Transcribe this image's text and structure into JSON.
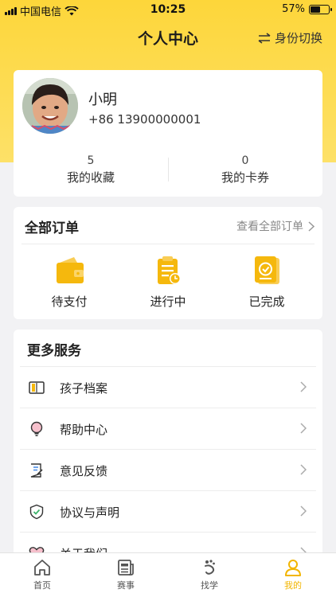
{
  "status_bar": {
    "carrier": "中国电信",
    "time": "10:25",
    "battery": "57%",
    "battery_level": 0.57
  },
  "header": {
    "title": "个人中心",
    "switch_label": "身份切换",
    "switch_icon": "swap-icon"
  },
  "profile": {
    "name": "小明",
    "phone": "+86 13900000001",
    "stats": [
      {
        "count": "5",
        "label": "我的收藏"
      },
      {
        "count": "0",
        "label": "我的卡券"
      }
    ]
  },
  "orders": {
    "title": "全部订单",
    "view_all": "查看全部订单",
    "items": [
      {
        "label": "待支付",
        "icon": "wallet-icon"
      },
      {
        "label": "进行中",
        "icon": "clipboard-clock-icon"
      },
      {
        "label": "已完成",
        "icon": "clipboard-check-icon"
      }
    ]
  },
  "services": {
    "title": "更多服务",
    "items": [
      {
        "label": "孩子档案",
        "icon": "folder-icon"
      },
      {
        "label": "帮助中心",
        "icon": "lightbulb-icon"
      },
      {
        "label": "意见反馈",
        "icon": "feedback-icon"
      },
      {
        "label": "协议与声明",
        "icon": "shield-check-icon"
      },
      {
        "label": "关于我们",
        "icon": "heart-icon"
      }
    ]
  },
  "tabs": [
    {
      "label": "首页",
      "icon": "home-icon",
      "active": false
    },
    {
      "label": "赛事",
      "icon": "news-icon",
      "active": false
    },
    {
      "label": "找学",
      "icon": "find-icon",
      "active": false
    },
    {
      "label": "我的",
      "icon": "profile-icon",
      "active": true
    }
  ],
  "colors": {
    "brand_yellow": "#fdd63a",
    "icon_yellow": "#f5b80d",
    "active_tab": "#f2b500"
  }
}
